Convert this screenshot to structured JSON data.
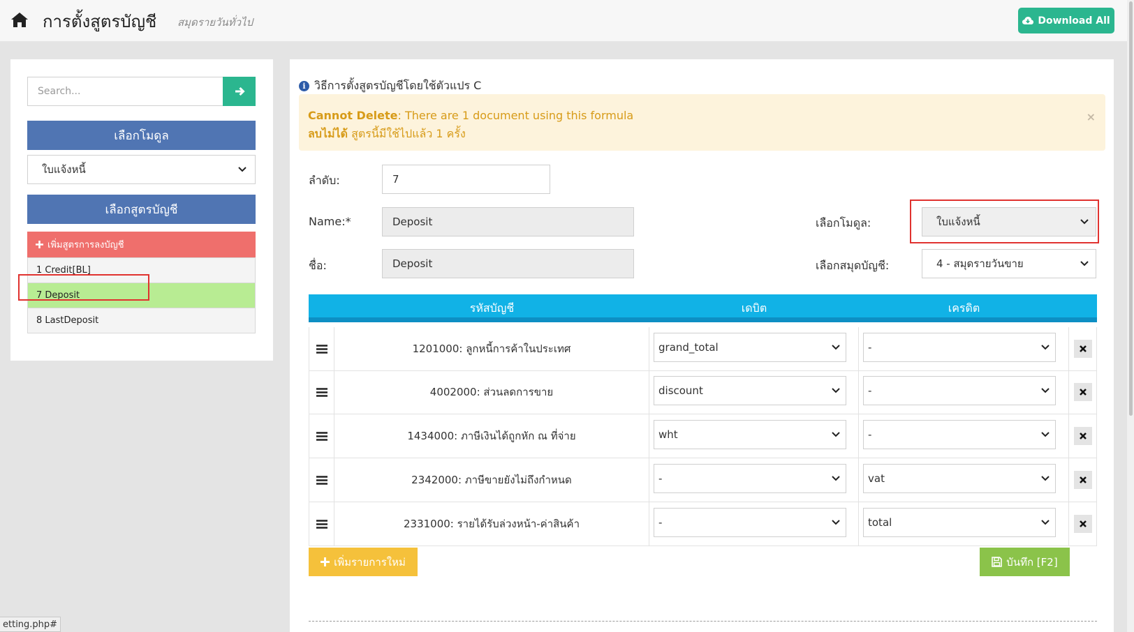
{
  "header": {
    "title": "การตั้งสูตรบัญชี",
    "subtitle": "สมุดรายวันทั่วไป",
    "download_label": "Download All"
  },
  "sidebar": {
    "search_placeholder": "Search...",
    "module_header": "เลือกโมดูล",
    "module_value": "ใบแจ้งหนี้",
    "formula_header": "เลือกสูตรบัญชี",
    "add_formula_label": "เพิ่มสูตรการลงบัญชี",
    "formulas": [
      {
        "label": "1 Credit[BL]",
        "active": false
      },
      {
        "label": "7 Deposit",
        "active": true
      },
      {
        "label": "8 LastDeposit",
        "active": false
      }
    ]
  },
  "main": {
    "info_text": "วิธีการตั้งสูตรบัญชีโดยใช้ตัวแปร C",
    "alert": {
      "line1_bold": "Cannot Delete",
      "line1_text": ": There are 1 document using this formula",
      "line2_bold": "ลบไม่ได้",
      "line2_text": " สูตรนี้มีใช้ไปแล้ว 1 ครั้ง",
      "close": "×"
    },
    "form": {
      "order_label": "ลำดับ:",
      "order_value": "7",
      "name_label": "Name:*",
      "name_value": "Deposit",
      "thai_name_label": "ชื่อ:",
      "thai_name_value": "Deposit",
      "module_label": "เลือกโมดูล:",
      "module_value": "ใบแจ้งหนี้",
      "journal_label": "เลือกสมุดบัญชี:",
      "journal_value": "4 - สมุดรายวันขาย"
    },
    "table": {
      "headers": {
        "account": "รหัสบัญชี",
        "debit": "เดบิต",
        "credit": "เครดิต"
      },
      "rows": [
        {
          "account": "1201000: ลูกหนี้การค้าในประเทศ",
          "debit": "grand_total",
          "credit": "-"
        },
        {
          "account": "4002000: ส่วนลดการขาย",
          "debit": "discount",
          "credit": "-"
        },
        {
          "account": "1434000: ภาษีเงินได้ถูกหัก ณ ที่จ่าย",
          "debit": "wht",
          "credit": "-"
        },
        {
          "account": "2342000: ภาษีขายยังไม่ถึงกำหนด",
          "debit": "-",
          "credit": "vat"
        },
        {
          "account": "2331000: รายได้รับล่วงหน้า-ค่าสินค้า",
          "debit": "-",
          "credit": "total"
        }
      ]
    },
    "add_row_label": "เพิ่มรายการใหม่",
    "save_label": "บันทึก [F2]"
  },
  "status_url": "etting.php#",
  "colors": {
    "accent_green": "#2bb68f",
    "panel_blue": "#5075b3",
    "table_header": "#11b2e6",
    "add_formula_red": "#ef6f6c",
    "active_item": "#b8ec93",
    "add_button": "#f5c13b",
    "save_button": "#8bc34a",
    "highlight_box": "#e0322f"
  }
}
